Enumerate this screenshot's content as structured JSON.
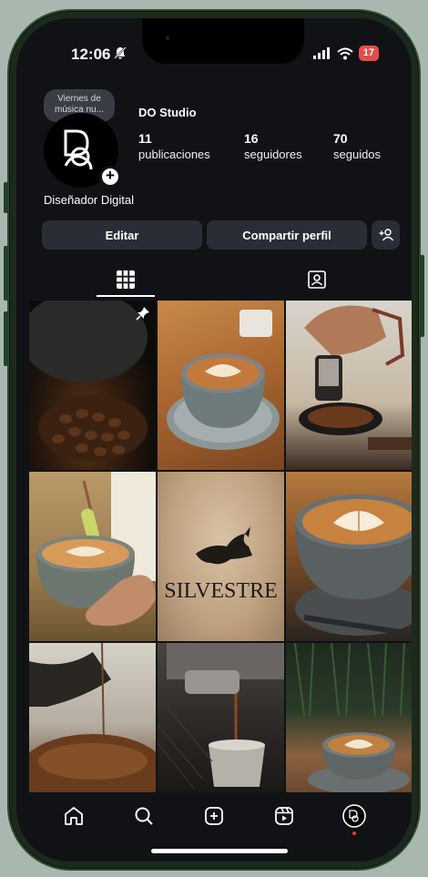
{
  "status": {
    "time": "12:06",
    "battery": "17"
  },
  "note": {
    "text": "Viernes de música nu..."
  },
  "profile": {
    "name": "DO Studio",
    "bio": "Diseñador Digital",
    "stats": [
      {
        "num": "11",
        "label": "publicaciones"
      },
      {
        "num": "16",
        "label": "seguidores"
      },
      {
        "num": "70",
        "label": "seguidos"
      }
    ]
  },
  "actions": {
    "edit": "Editar",
    "share": "Compartir perfil"
  },
  "grid_text": {
    "silvestre": "SILVESTRE"
  },
  "icons": {
    "grid": "grid-icon",
    "tagged": "tagged-icon",
    "home": "home-icon",
    "search": "search-icon",
    "create": "plus-square-icon",
    "reels": "reels-icon",
    "profile": "profile-avatar-icon",
    "pin": "pin-icon",
    "add_user": "add-user-icon"
  },
  "colors": {
    "background": "#101216",
    "button": "#2a2d34",
    "battery": "#e64b4b",
    "notification": "#ff3040"
  }
}
